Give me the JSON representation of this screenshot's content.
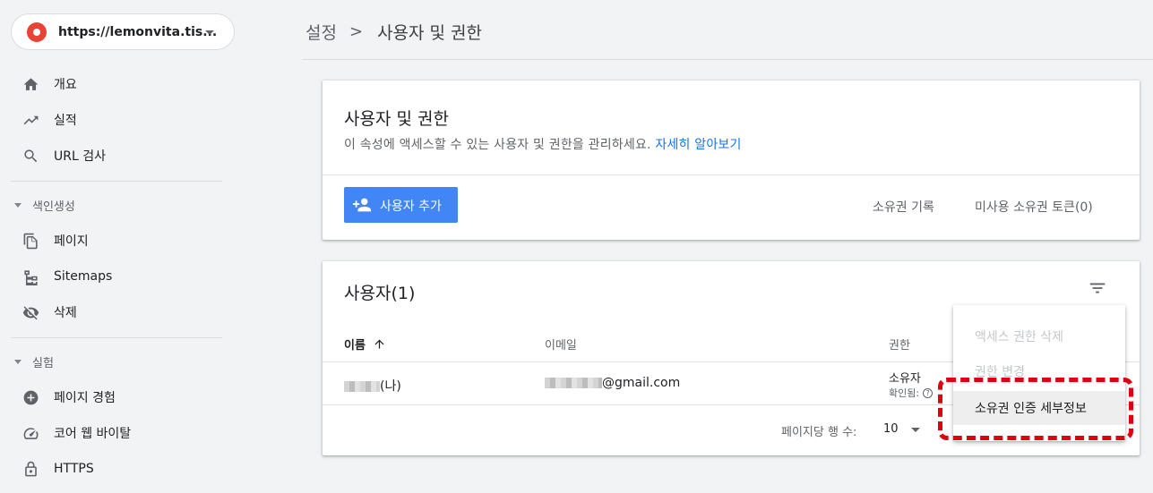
{
  "property": {
    "url": "https://lemonvita.tis..."
  },
  "sidebar": {
    "items_top": [
      {
        "label": "개요",
        "icon": "home-icon"
      },
      {
        "label": "실적",
        "icon": "trending-up-icon"
      },
      {
        "label": "URL 검사",
        "icon": "search-icon"
      }
    ],
    "section_index": "색인생성",
    "items_index": [
      {
        "label": "페이지",
        "icon": "pages-icon"
      },
      {
        "label": "Sitemaps",
        "icon": "sitemap-icon"
      },
      {
        "label": "삭제",
        "icon": "eye-off-icon"
      }
    ],
    "section_experience": "실험",
    "items_experience": [
      {
        "label": "페이지 경험",
        "icon": "plus-circle-icon"
      },
      {
        "label": "코어 웹 바이탈",
        "icon": "speedometer-icon"
      },
      {
        "label": "HTTPS",
        "icon": "lock-icon"
      }
    ]
  },
  "breadcrumb": {
    "parent": "설정",
    "separator": ">",
    "current": "사용자 및 권한"
  },
  "permissions_card": {
    "title": "사용자 및 권한",
    "description": "이 속성에 액세스할 수 있는 사용자 및 권한을 관리하세요.",
    "learn_more": "자세히 알아보기",
    "add_user": "사용자 추가",
    "ownership_history": "소유권 기록",
    "unused_tokens": "미사용 소유권 토큰(0)"
  },
  "users_card": {
    "title": "사용자(1)",
    "columns": {
      "name": "이름",
      "email": "이메일",
      "permission": "권한"
    },
    "rows": [
      {
        "name_suffix": "(나)",
        "email_suffix": "@gmail.com",
        "permission": "소유자",
        "verified_label": "확인됨:",
        "help": "?"
      }
    ],
    "pager_label": "페이지당 행 수:",
    "pager_value": "10"
  },
  "menu": {
    "items": [
      {
        "label": "액세스 권한 삭제",
        "state": "disabled"
      },
      {
        "label": "권한 변경",
        "state": "disabled"
      },
      {
        "label": "소유권 인증 세부정보",
        "state": "hover"
      }
    ]
  },
  "colors": {
    "accent": "#4285f4",
    "link": "#1a73e8",
    "highlight": "#e0000f",
    "logo": "#ea4335"
  }
}
